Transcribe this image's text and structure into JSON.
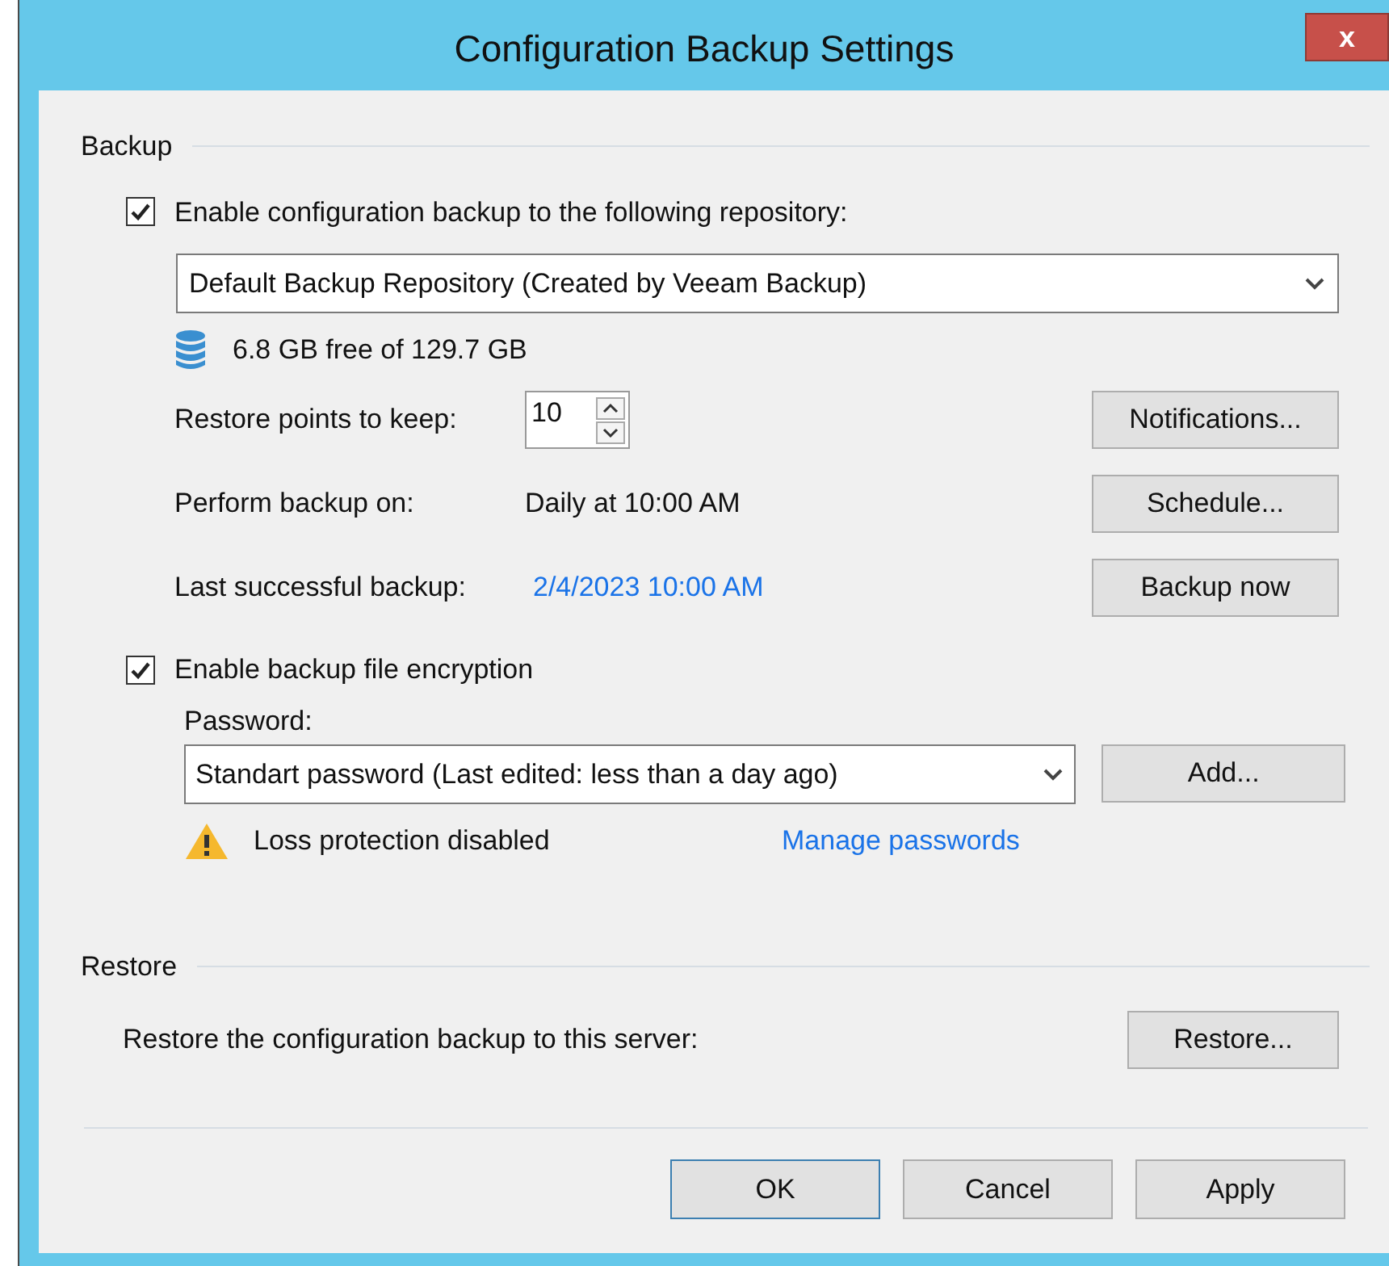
{
  "window": {
    "title": "Configuration Backup Settings",
    "close": "x"
  },
  "backup": {
    "heading": "Backup",
    "enable": {
      "label": "Enable configuration backup to the following repository:",
      "checked": true
    },
    "repository": "Default Backup Repository (Created by Veeam Backup)",
    "free_space": "6.8 GB free of 129.7 GB",
    "restore_points": {
      "label": "Restore points to keep:",
      "value": "10"
    },
    "perform": {
      "label": "Perform backup on:",
      "value": "Daily at 10:00 AM"
    },
    "last": {
      "label": "Last successful backup:",
      "value": "2/4/2023 10:00 AM"
    },
    "buttons": [
      "Notifications...",
      "Schedule...",
      "Backup now"
    ],
    "encryption": {
      "label": "Enable backup file encryption",
      "checked": true
    },
    "password_label": "Password:",
    "password": "Standart password (Last edited: less than a day ago)",
    "add_button": "Add...",
    "warning": "Loss protection disabled",
    "manage_link": "Manage passwords"
  },
  "restore": {
    "heading": "Restore",
    "text": "Restore the configuration backup to this server:",
    "button": "Restore..."
  },
  "footer_buttons": [
    {
      "label": "OK",
      "default": true
    },
    {
      "label": "Cancel",
      "default": false
    },
    {
      "label": "Apply",
      "default": false
    }
  ]
}
